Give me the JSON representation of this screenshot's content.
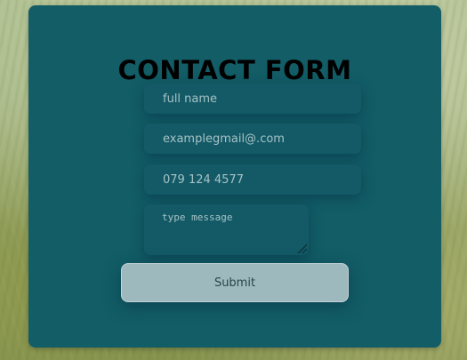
{
  "form": {
    "title": "CONTACT FORM",
    "name_placeholder": "full name",
    "email_placeholder": "examplegmail@.com",
    "phone_placeholder": "079 124 4577",
    "message_placeholder": "type message",
    "submit_label": "Submit"
  },
  "colors": {
    "card_background": "#125d66",
    "title_text": "#000000",
    "field_background": "#135a66",
    "placeholder_text": "#a6c2c6",
    "button_background": "#9db9bd",
    "button_text": "#29464b"
  },
  "icons": {
    "resize_handle": "textarea-resize-grip"
  }
}
